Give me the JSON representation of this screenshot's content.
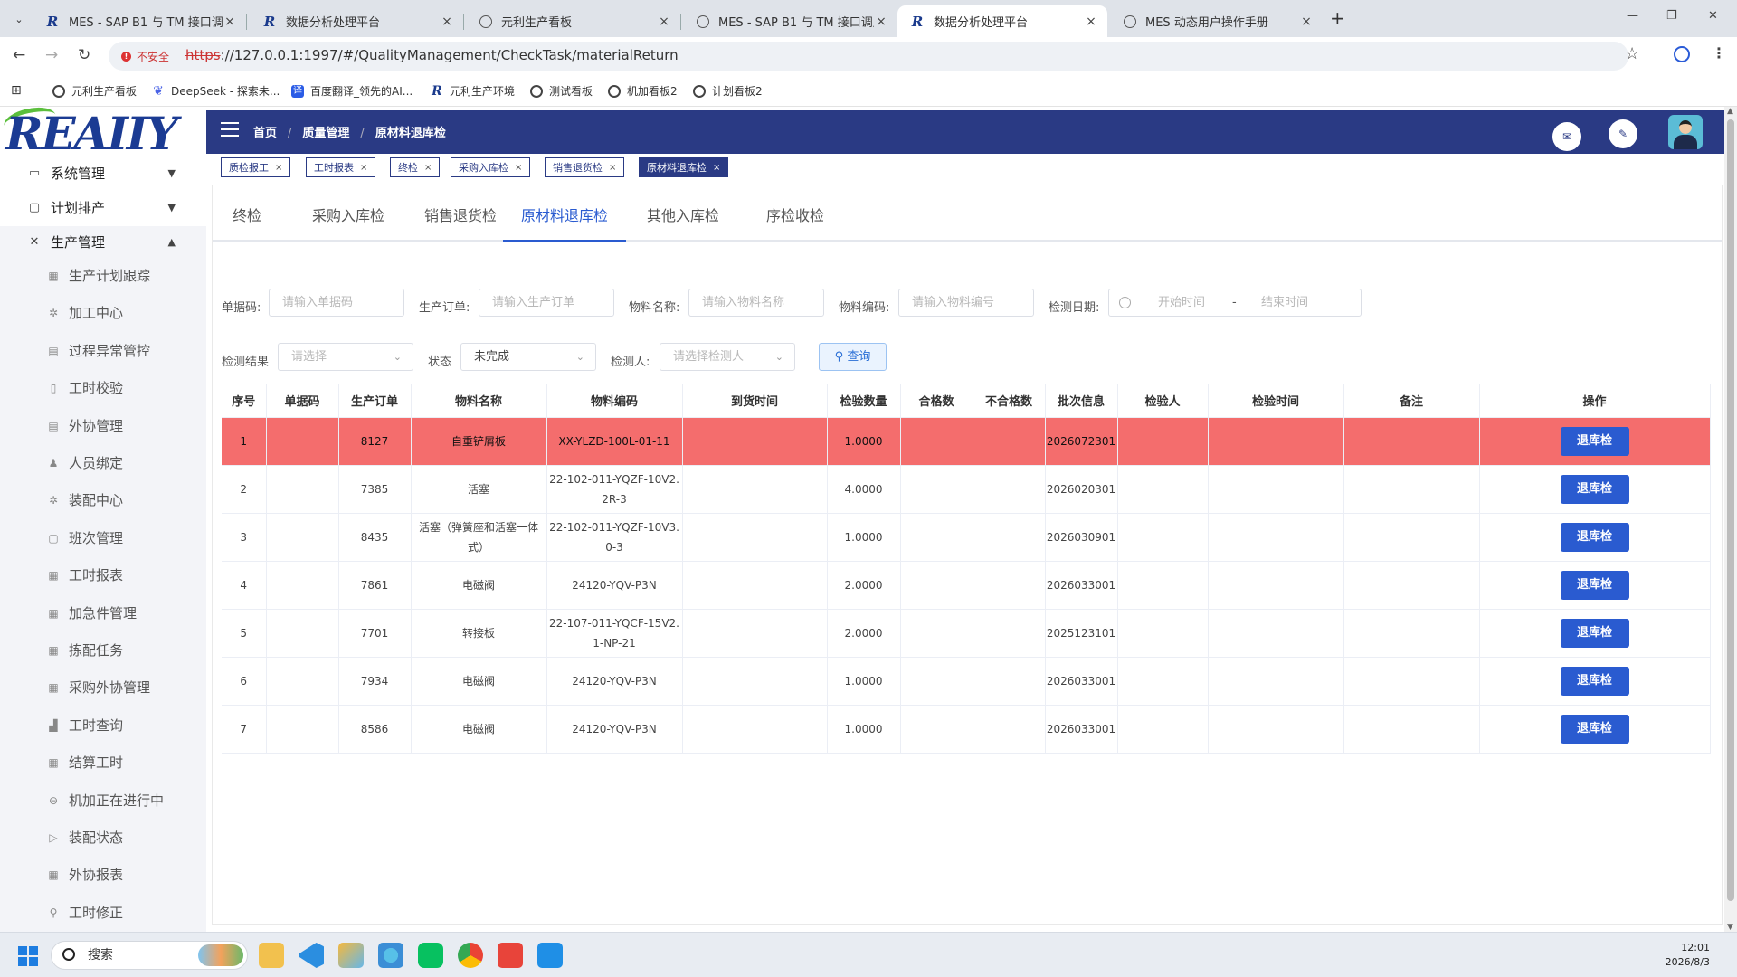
{
  "browser": {
    "tabs": [
      {
        "title": "MES - SAP B1 与 TM 接口调用",
        "active": false
      },
      {
        "title": "数据分析处理平台",
        "active": false
      },
      {
        "title": "元利生产看板",
        "active": false
      },
      {
        "title": "MES - SAP B1 与 TM 接口调用",
        "active": false
      },
      {
        "title": "数据分析处理平台",
        "active": true
      },
      {
        "title": "MES 动态用户操作手册",
        "active": false
      }
    ],
    "insecure_label": "不安全",
    "url_scheme": "https",
    "url_rest": "://127.0.0.1:1997/#/QualityManagement/CheckTask/materialReturn",
    "bookmarks": [
      "元利生产看板",
      "DeepSeek - 探索未...",
      "百度翻译_领先的AI...",
      "元利生产环境",
      "测试看板",
      "机加看板2",
      "计划看板2"
    ]
  },
  "app": {
    "logo_text": "REAIIY",
    "breadcrumb": [
      "首页",
      "质量管理",
      "原材料退库检"
    ],
    "menu_parents": [
      {
        "label": "系统管理",
        "icon": "monitor-icon",
        "expanded": false
      },
      {
        "label": "计划排产",
        "icon": "document-icon",
        "expanded": false
      },
      {
        "label": "生产管理",
        "icon": "tools-icon",
        "expanded": true
      }
    ],
    "submenu": [
      {
        "label": "生产计划跟踪",
        "icon": "table-icon"
      },
      {
        "label": "加工中心",
        "icon": "gear-icon"
      },
      {
        "label": "过程异常管控",
        "icon": "document-icon"
      },
      {
        "label": "工时校验",
        "icon": "document-icon"
      },
      {
        "label": "外协管理",
        "icon": "document-icon"
      },
      {
        "label": "人员绑定",
        "icon": "user-icon"
      },
      {
        "label": "装配中心",
        "icon": "gear-icon"
      },
      {
        "label": "班次管理",
        "icon": "document-icon"
      },
      {
        "label": "工时报表",
        "icon": "table-icon"
      },
      {
        "label": "加急件管理",
        "icon": "table-icon"
      },
      {
        "label": "拣配任务",
        "icon": "table-icon"
      },
      {
        "label": "采购外协管理",
        "icon": "table-icon"
      },
      {
        "label": "工时查询",
        "icon": "chart-icon"
      },
      {
        "label": "结算工时",
        "icon": "table-icon"
      },
      {
        "label": "机加正在进行中",
        "icon": "circle-icon"
      },
      {
        "label": "装配状态",
        "icon": "play-icon"
      },
      {
        "label": "外协报表",
        "icon": "table-icon"
      },
      {
        "label": "工时修正",
        "icon": "search-icon"
      }
    ],
    "open_tags": [
      {
        "label": "质检报工",
        "active": false
      },
      {
        "label": "工时报表",
        "active": false
      },
      {
        "label": "终检",
        "active": false
      },
      {
        "label": "采购入库检",
        "active": false
      },
      {
        "label": "销售退货检",
        "active": false
      },
      {
        "label": "原材料退库检",
        "active": true
      }
    ],
    "quality_tabs": [
      {
        "label": "终检",
        "active": false
      },
      {
        "label": "采购入库检",
        "active": false
      },
      {
        "label": "销售退货检",
        "active": false
      },
      {
        "label": "原材料退库检",
        "active": true
      },
      {
        "label": "其他入库检",
        "active": false
      },
      {
        "label": "序检收检",
        "active": false
      }
    ]
  },
  "filters": {
    "doc_code": {
      "label": "单据码:",
      "placeholder": "请输入单据码"
    },
    "prod_order": {
      "label": "生产订单:",
      "placeholder": "请输入生产订单"
    },
    "material_name": {
      "label": "物料名称:",
      "placeholder": "请输入物料名称"
    },
    "material_code": {
      "label": "物料编码:",
      "placeholder": "请输入物料编号"
    },
    "check_date": {
      "label": "检测日期:",
      "start_placeholder": "开始时间",
      "separator": "-",
      "end_placeholder": "结束时间"
    },
    "result": {
      "label": "检测结果",
      "placeholder": "请选择"
    },
    "status": {
      "label": "状态",
      "value": "未完成"
    },
    "inspector": {
      "label": "检测人:",
      "placeholder": "请选择检测人"
    },
    "query_label": "查询"
  },
  "table": {
    "headers": [
      "序号",
      "单据码",
      "生产订单",
      "物料名称",
      "物料编码",
      "到货时间",
      "检验数量",
      "合格数",
      "不合格数",
      "批次信息",
      "检验人",
      "检验时间",
      "备注",
      "操作"
    ],
    "action_label": "退库检",
    "highlight_color": "#f46d6d",
    "rows": [
      {
        "no": "1",
        "doc": "",
        "order": "8127",
        "name": "自重铲屑板",
        "code": "XX-YLZD-100L-01-11",
        "arrival": "",
        "qty": "1.0000",
        "pass": "",
        "fail": "",
        "batch": "2026072301",
        "inspector": "",
        "time": "",
        "remark": "",
        "highlight": true
      },
      {
        "no": "2",
        "doc": "",
        "order": "7385",
        "name": "活塞",
        "code": "22-102-011-YQZF-10V2.2R-3",
        "arrival": "",
        "qty": "4.0000",
        "pass": "",
        "fail": "",
        "batch": "2026020301",
        "inspector": "",
        "time": "",
        "remark": "",
        "highlight": false
      },
      {
        "no": "3",
        "doc": "",
        "order": "8435",
        "name": "活塞（弹簧座和活塞一体式）",
        "code": "22-102-011-YQZF-10V3.0-3",
        "arrival": "",
        "qty": "1.0000",
        "pass": "",
        "fail": "",
        "batch": "2026030901",
        "inspector": "",
        "time": "",
        "remark": "",
        "highlight": false
      },
      {
        "no": "4",
        "doc": "",
        "order": "7861",
        "name": "电磁阀",
        "code": "24120-YQV-P3N",
        "arrival": "",
        "qty": "2.0000",
        "pass": "",
        "fail": "",
        "batch": "2026033001",
        "inspector": "",
        "time": "",
        "remark": "",
        "highlight": false
      },
      {
        "no": "5",
        "doc": "",
        "order": "7701",
        "name": "转接板",
        "code": "22-107-011-YQCF-15V2.1-NP-21",
        "arrival": "",
        "qty": "2.0000",
        "pass": "",
        "fail": "",
        "batch": "2025123101",
        "inspector": "",
        "time": "",
        "remark": "",
        "highlight": false
      },
      {
        "no": "6",
        "doc": "",
        "order": "7934",
        "name": "电磁阀",
        "code": "24120-YQV-P3N",
        "arrival": "",
        "qty": "1.0000",
        "pass": "",
        "fail": "",
        "batch": "2026033001",
        "inspector": "",
        "time": "",
        "remark": "",
        "highlight": false
      },
      {
        "no": "7",
        "doc": "",
        "order": "8586",
        "name": "电磁阀",
        "code": "24120-YQV-P3N",
        "arrival": "",
        "qty": "1.0000",
        "pass": "",
        "fail": "",
        "batch": "2026033001",
        "inspector": "",
        "time": "",
        "remark": "",
        "highlight": false
      }
    ]
  },
  "taskbar": {
    "search_label": "搜索",
    "time": "12:01",
    "date": "2026/8/3"
  }
}
